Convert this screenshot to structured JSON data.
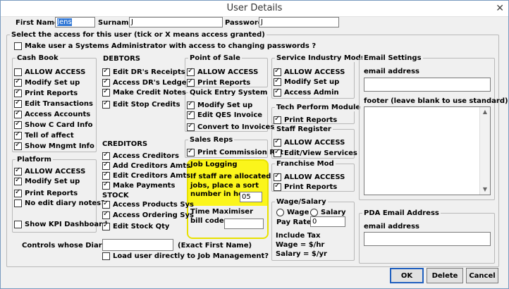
{
  "window": {
    "title": "User Details",
    "close_glyph": "✕"
  },
  "header": {
    "first_name_label": "First Name",
    "first_name_value": "Jens",
    "surname_label": "Surname",
    "surname_value": "J",
    "password_label": "Password",
    "password_value": "J"
  },
  "access": {
    "title": "Select the access for this user (tick or X means access granted)",
    "sysadmin_label": "Make user a Systems Administrator with access to changing passwords ?"
  },
  "cashbook": {
    "title": "Cash Book",
    "items": [
      {
        "label": "ALLOW ACCESS",
        "checked": false
      },
      {
        "label": "Modify Set up",
        "checked": true
      },
      {
        "label": "Print Reports",
        "checked": true
      },
      {
        "label": "Edit Transactions",
        "checked": true
      },
      {
        "label": "Access Accounts",
        "checked": true
      },
      {
        "label": "Show C Card Info",
        "checked": true
      },
      {
        "label": "Tell of affect",
        "checked": true
      },
      {
        "label": "Show Mngmt Info",
        "checked": true
      }
    ]
  },
  "platform": {
    "title": "Platform",
    "items": [
      {
        "label": "ALLOW ACCESS",
        "checked": true
      },
      {
        "label": "Modify Set up",
        "checked": true
      },
      {
        "label": "Print Reports",
        "checked": true
      },
      {
        "label": "No edit diary notes?",
        "checked": false
      },
      {
        "label": "Show KPI Dashboard",
        "checked": false
      }
    ]
  },
  "debtors": {
    "title": "DEBTORS",
    "items": [
      {
        "label": "Edit DR's Receipts",
        "checked": true
      },
      {
        "label": "Access DR's Ledger",
        "checked": true
      },
      {
        "label": "Make Credit Notes",
        "checked": true
      },
      {
        "label": "Edit Stop Credits",
        "checked": true
      }
    ]
  },
  "creditors": {
    "title": "CREDITORS",
    "items": [
      {
        "label": "Access Creditors",
        "checked": true
      },
      {
        "label": "Add Creditors Amts",
        "checked": true
      },
      {
        "label": "Edit Creditors Amts",
        "checked": true
      },
      {
        "label": "Make Payments",
        "checked": true
      }
    ]
  },
  "stock": {
    "title": "STOCK",
    "items": [
      {
        "label": "Access Products Sys",
        "checked": true
      },
      {
        "label": "Access Ordering Sys",
        "checked": true
      },
      {
        "label": "Edit Stock Qty",
        "checked": true
      }
    ]
  },
  "pos": {
    "title": "Point of Sale",
    "items": [
      {
        "label": "ALLOW ACCESS",
        "checked": true
      },
      {
        "label": "Print Reports",
        "checked": true
      }
    ]
  },
  "qes": {
    "title": "Quick Entry System",
    "items": [
      {
        "label": "Modify Set up",
        "checked": true
      },
      {
        "label": "Edit QES Invoice",
        "checked": true
      },
      {
        "label": "Convert to Invoices",
        "checked": true
      }
    ]
  },
  "salesreps": {
    "title": "Sales Reps",
    "items": [
      {
        "label": "Print Commission Rpt",
        "checked": true
      }
    ]
  },
  "joblogging": {
    "title": "Job Logging",
    "text_line1": "If staff are allocated",
    "text_line2": "jobs, place a sort",
    "text_line3": "number in here.",
    "sort_value": "05",
    "tm_label_line1": "Time Maximiser",
    "tm_label_line2": "bill code",
    "tm_value": ""
  },
  "service": {
    "title": "Service Industry Module",
    "items": [
      {
        "label": "ALLOW ACCESS",
        "checked": true
      },
      {
        "label": "Modify Set up",
        "checked": true
      },
      {
        "label": "Access Admin",
        "checked": true
      }
    ]
  },
  "tech": {
    "title": "Tech Perform Module",
    "items": [
      {
        "label": "Print Reports",
        "checked": true
      }
    ]
  },
  "staff": {
    "title": "Staff Register",
    "items": [
      {
        "label": "ALLOW ACCESS",
        "checked": true
      },
      {
        "label": "Edit/View Services",
        "checked": true
      }
    ]
  },
  "franchise": {
    "title": "Franchise Mod",
    "items": [
      {
        "label": "ALLOW ACCESS",
        "checked": true
      },
      {
        "label": "Print Reports",
        "checked": true
      }
    ]
  },
  "wage": {
    "title": "Wage/Salary",
    "wage_label": "Wage",
    "salary_label": "Salary",
    "payrate_label": "Pay Rate",
    "payrate_value": "0",
    "include_tax": "Include Tax",
    "wage_unit": "Wage = $/hr",
    "salary_unit": "Salary = $/yr"
  },
  "email": {
    "title": "Email Settings",
    "address_label": "email address",
    "address_value": "",
    "footer_label": "footer (leave blank to use standard)",
    "footer_value": "",
    "scroll_up": "▲",
    "scroll_down": "▼"
  },
  "pda": {
    "title": "PDA Email Address",
    "address_label": "email address",
    "address_value": ""
  },
  "diary": {
    "label": "Controls whose Diary?",
    "value": "",
    "hint": "(Exact First Name)",
    "load_label": "Load user directly to Job Management?"
  },
  "buttons": {
    "ok": "OK",
    "delete": "Delete",
    "cancel": "Cancel"
  }
}
